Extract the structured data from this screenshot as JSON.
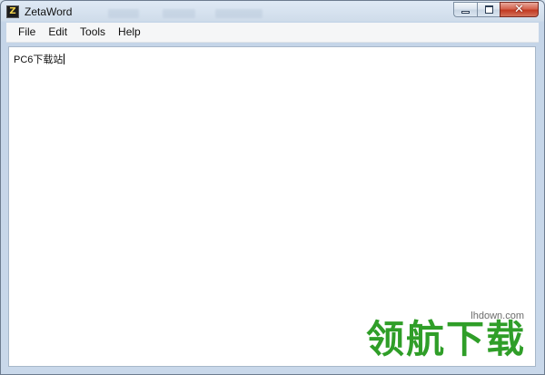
{
  "window": {
    "title": "ZetaWord",
    "app_icon_glyph": "Z",
    "controls": {
      "minimize_icon": "minimize-icon",
      "maximize_icon": "maximize-icon",
      "close_glyph": "✕"
    }
  },
  "menu": {
    "items": [
      {
        "label": "File"
      },
      {
        "label": "Edit"
      },
      {
        "label": "Tools"
      },
      {
        "label": "Help"
      }
    ]
  },
  "editor": {
    "content": "PC6下载站"
  },
  "watermark": {
    "url": "lhdown.com",
    "brand": "领航下载"
  },
  "colors": {
    "close_button": "#c23a22",
    "watermark_green": "#2f9e28",
    "menubar_bg": "#f5f6f7",
    "frame_bg": "#c9d8ea"
  }
}
